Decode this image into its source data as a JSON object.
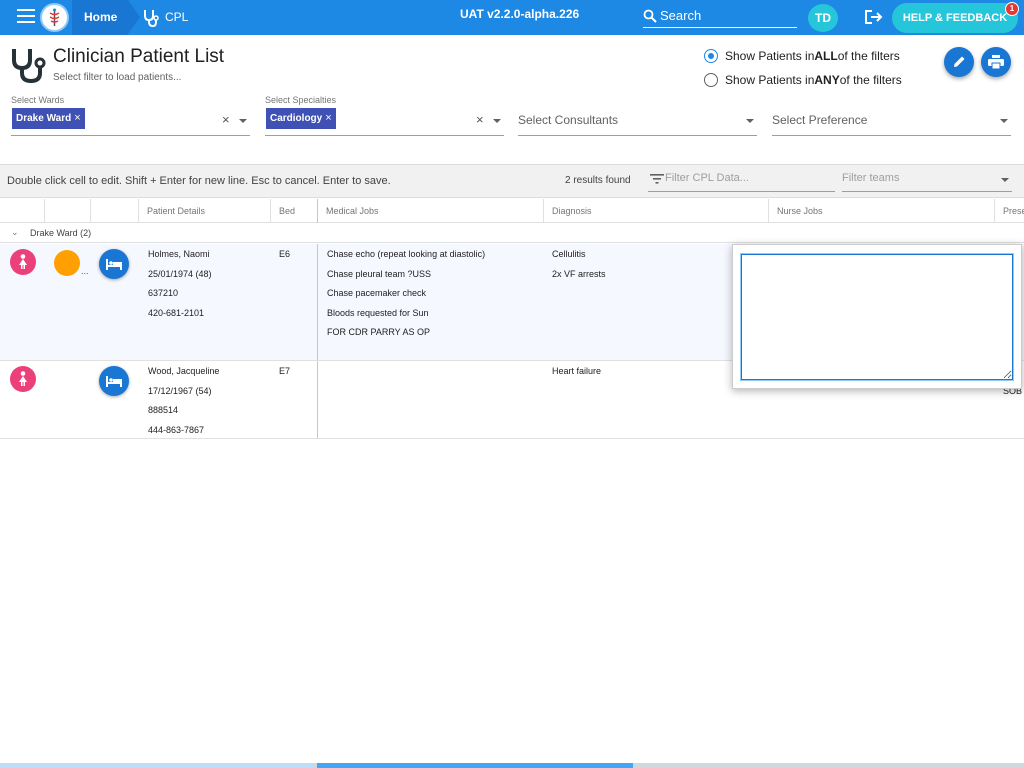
{
  "topbar": {
    "home_label": "Home",
    "cpl_label": "CPL",
    "version": "UAT v2.2.0-alpha.226",
    "search_label": "Search",
    "avatar_initials": "TD",
    "help_label": "HELP & FEEDBACK",
    "help_badge": "1"
  },
  "header": {
    "title": "Clinician Patient List",
    "subtitle": "Select filter to load patients...",
    "radio_all": {
      "prefix": "Show Patients in ",
      "bold": "ALL",
      "suffix": " of the filters",
      "selected": true
    },
    "radio_any": {
      "prefix": "Show Patients in ",
      "bold": "ANY",
      "suffix": " of the filters",
      "selected": false
    }
  },
  "filters": {
    "wards_label": "Select Wards",
    "wards_chip": "Drake Ward",
    "specialties_label": "Select Specialties",
    "specialties_chip": "Cardiology",
    "consultants_placeholder": "Select Consultants",
    "preference_placeholder": "Select Preference",
    "clear_glyph": "×",
    "chip_remove_glyph": "×"
  },
  "toolbar": {
    "hint": "Double click cell to edit. Shift + Enter for new line. Esc to cancel. Enter to save.",
    "results": "2 results found",
    "filter_cpl_placeholder": "Filter CPL Data...",
    "filter_teams_placeholder": "Filter teams"
  },
  "grid": {
    "columns": [
      "Patient Details",
      "Bed",
      "Medical Jobs",
      "Diagnosis",
      "Nurse Jobs",
      "Prese"
    ],
    "group_label": "Drake Ward (2)",
    "rows": [
      {
        "name": "Holmes, Naomi",
        "dob": "25/01/1974 (48)",
        "id": "637210",
        "phone": "420-681-2101",
        "bed": "E6",
        "medical_jobs": [
          "Chase echo (repeat looking at diastolic)",
          "Chase pleural team ?USS",
          "Chase pacemaker check",
          "Bloods requested for Sun",
          "FOR CDR PARRY AS OP"
        ],
        "diagnosis": [
          "Cellulitis",
          "2x VF arrests"
        ],
        "overflow": "..."
      },
      {
        "name": "Wood, Jacqueline",
        "dob": "17/12/1967 (54)",
        "id": "888514",
        "phone": "444-863-7867",
        "bed": "E7",
        "medical_jobs": [],
        "diagnosis": [
          "Heart failure"
        ],
        "presenting_peek": "SOB"
      }
    ]
  },
  "editor": {
    "value": ""
  },
  "colors": {
    "primary": "#1e88e5",
    "chip": "#3f51b5",
    "accent": "#26c6da",
    "female": "#ec407a",
    "alert": "#ffa000"
  }
}
